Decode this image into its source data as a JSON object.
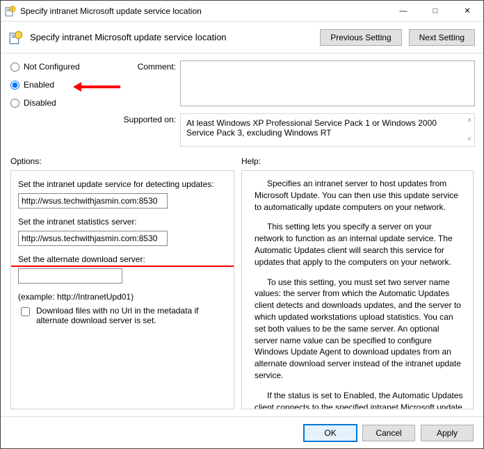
{
  "window": {
    "title": "Specify intranet Microsoft update service location"
  },
  "header": {
    "title": "Specify intranet Microsoft update service location",
    "prev_btn": "Previous Setting",
    "next_btn": "Next Setting"
  },
  "state": {
    "not_configured": "Not Configured",
    "enabled": "Enabled",
    "disabled": "Disabled",
    "selected": "enabled"
  },
  "labels": {
    "comment": "Comment:",
    "supported_on": "Supported on:",
    "options": "Options:",
    "help": "Help:"
  },
  "comment_value": "",
  "supported_text": "At least Windows XP Professional Service Pack 1 or Windows 2000 Service Pack 3, excluding Windows RT",
  "options": {
    "update_service_label": "Set the intranet update service for detecting updates:",
    "update_service_value": "http://wsus.techwithjasmin.com:8530",
    "stats_server_label": "Set the intranet statistics server:",
    "stats_server_value": "http://wsus.techwithjasmin.com:8530",
    "alt_download_label": "Set the alternate download server:",
    "alt_download_value": "",
    "example_text": "(example: http://IntranetUpd01)",
    "chk_label": "Download files with no Url in the metadata if alternate download server is set.",
    "chk_checked": false
  },
  "help_paragraphs": [
    "Specifies an intranet server to host updates from Microsoft Update. You can then use this update service to automatically update computers on your network.",
    "This setting lets you specify a server on your network to function as an internal update service. The Automatic Updates client will search this service for updates that apply to the computers on your network.",
    "To use this setting, you must set two server name values: the server from which the Automatic Updates client detects and downloads updates, and the server to which updated workstations upload statistics. You can set both values to be the same server. An optional server name value can be specified to configure Windows Update Agent to download updates from an alternate download server instead of the intranet update service.",
    "If the status is set to Enabled, the Automatic Updates client connects to the specified intranet Microsoft update service (or alternate download server), instead of Windows Update, to"
  ],
  "footer": {
    "ok": "OK",
    "cancel": "Cancel",
    "apply": "Apply"
  }
}
